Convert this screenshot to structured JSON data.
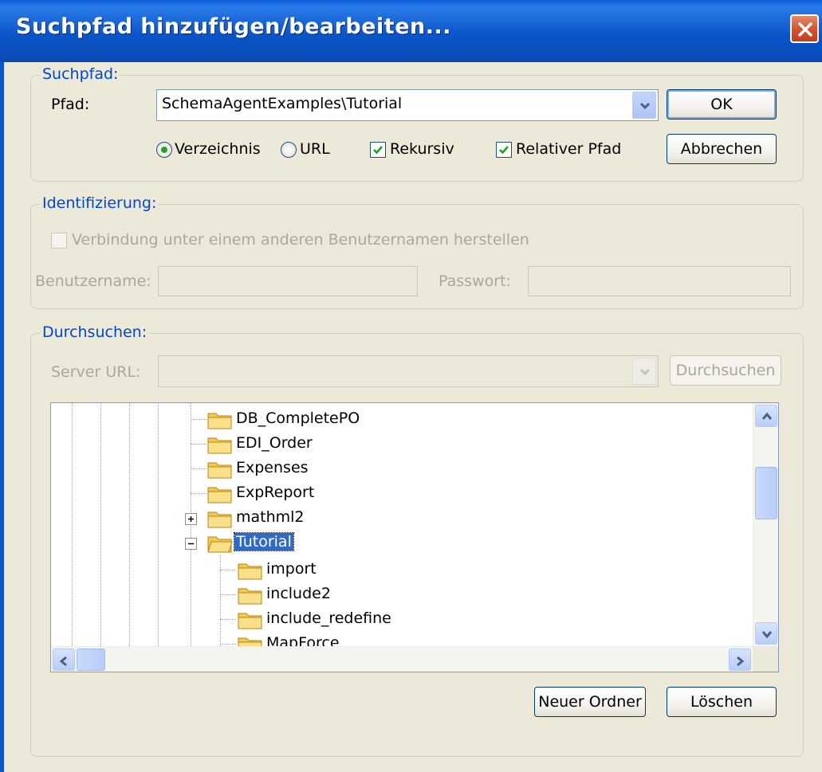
{
  "window": {
    "title": "Suchpfad hinzufügen/bearbeiten..."
  },
  "suchpfad": {
    "legend": "Suchpfad:",
    "path_label": "Pfad:",
    "path_value": "SchemaAgentExamples\\Tutorial",
    "radio_dir": "Verzeichnis",
    "radio_url": "URL",
    "check_recursive": "Rekursiv",
    "check_relative": "Relativer Pfad",
    "ok_label": "OK",
    "cancel_label": "Abbrechen"
  },
  "ident": {
    "legend": "Identifizierung:",
    "check_other_user": "Verbindung unter einem anderen Benutzernamen herstellen",
    "user_label": "Benutzername:",
    "pass_label": "Passwort:"
  },
  "browse": {
    "legend": "Durchsuchen:",
    "server_label": "Server URL:",
    "browse_button": "Durchsuchen",
    "tree_items": [
      {
        "name": "DB_CompletePO"
      },
      {
        "name": "EDI_Order"
      },
      {
        "name": "Expenses"
      },
      {
        "name": "ExpReport"
      },
      {
        "name": "mathml2"
      },
      {
        "name": "Tutorial"
      },
      {
        "name": "import"
      },
      {
        "name": "include2"
      },
      {
        "name": "include_redefine"
      },
      {
        "name": "MapForce"
      }
    ],
    "selected_item": "Tutorial",
    "new_folder_button": "Neuer Ordner",
    "delete_button": "Löschen"
  },
  "colors": {
    "legend_blue": "#0046d5",
    "titlebar": "#0b55c9",
    "selection": "#316ac5"
  }
}
